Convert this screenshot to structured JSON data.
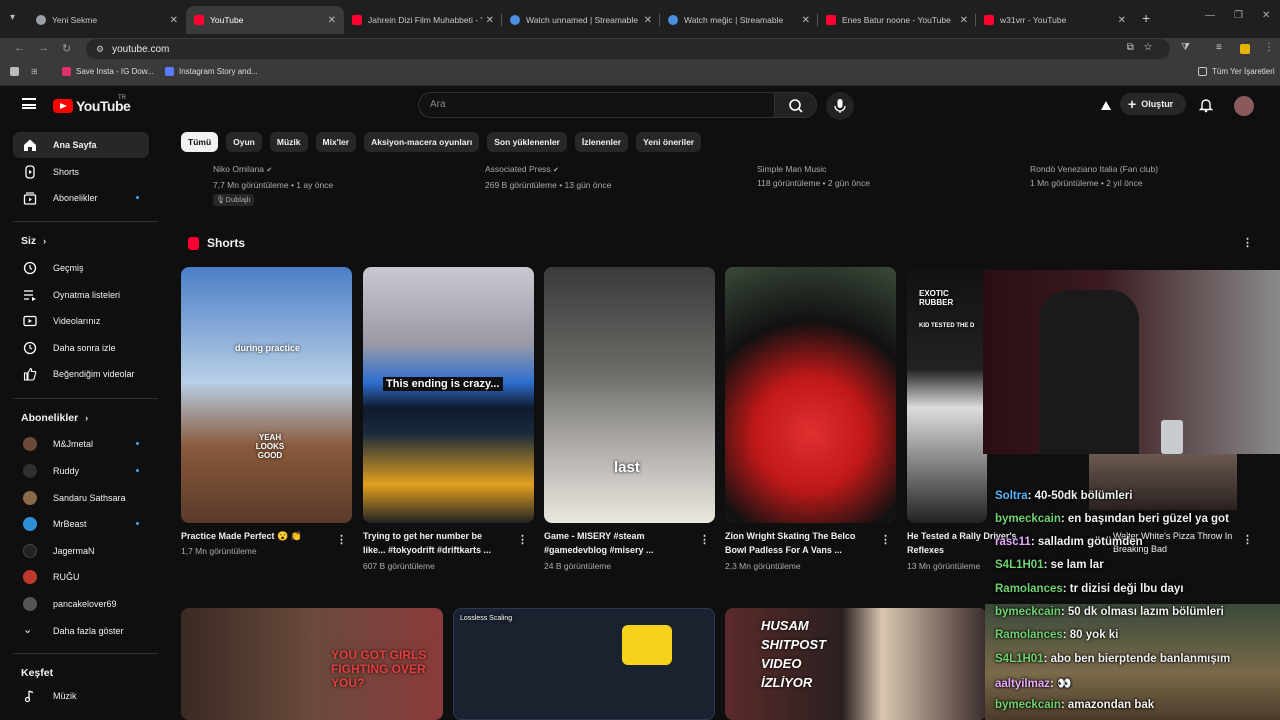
{
  "browser": {
    "tabs": [
      {
        "title": "Yeni Sekme",
        "color": "#9aa0a6"
      },
      {
        "title": "YouTube",
        "color": "#ff0033"
      },
      {
        "title": "Jahrein Dizi Film Muhabbeti - Y",
        "color": "#ff0033"
      },
      {
        "title": "Watch unnamed | Streamable",
        "color": "#4a90e2"
      },
      {
        "title": "Watch meğic | Streamable",
        "color": "#4a90e2"
      },
      {
        "title": "Enes Batur noone - YouTube",
        "color": "#ff0033"
      },
      {
        "title": "w31vrr - YouTube",
        "color": "#ff0033"
      }
    ],
    "url": "youtube.com",
    "bookmarks": [
      {
        "label": "Save Insta - IG Dow...",
        "color": "#e1306c"
      },
      {
        "label": "Instagram Story and...",
        "color": "#5b7cff"
      }
    ],
    "all_bookmarks": "Tüm Yer İşaretleri"
  },
  "yt": {
    "logo": "YouTube",
    "region": "TR",
    "search_placeholder": "Ara",
    "create": "Oluştur",
    "chips": [
      "Tümü",
      "Oyun",
      "Müzik",
      "Mix'ler",
      "Aksiyon-macera oyunları",
      "Son yüklenenler",
      "İzlenenler",
      "Yeni öneriler"
    ]
  },
  "sidebar": {
    "main": [
      "Ana Sayfa",
      "Shorts",
      "Abonelikler"
    ],
    "you_title": "Siz",
    "you": [
      "Geçmiş",
      "Oynatma listeleri",
      "Videolarınız",
      "Daha sonra izle",
      "Beğendiğim videolar"
    ],
    "subs_title": "Abonelikler",
    "subs": [
      "M&Jmetal",
      "Ruddy",
      "Sandaru Sathsara",
      "MrBeast",
      "JagermaN",
      "RUĞU",
      "pancakelover69"
    ],
    "more": "Daha fazla göster",
    "explore_title": "Keşfet",
    "explore": [
      "Müzik"
    ]
  },
  "videos_top": [
    {
      "channel": "Niko Omilana",
      "meta": "7,7 Mn görüntüleme • 1 ay önce",
      "badge": "Dublajlı"
    },
    {
      "channel": "Associated Press",
      "meta": "269 B görüntüleme • 13 gün önce"
    },
    {
      "channel": "Simple Man Music",
      "meta": "118 görüntüleme • 2 gün önce"
    },
    {
      "channel": "Rondò Veneziano Italia (Fan club)",
      "meta": "1 Mn görüntüleme • 2 yıl önce"
    }
  ],
  "shorts": {
    "title": "Shorts",
    "items": [
      {
        "title": "Practice Made Perfect 😮 👏",
        "title2": "",
        "views": "1,7 Mn görüntüleme",
        "caption": "during practice",
        "caption2": "YEAH LOOKS GOOD"
      },
      {
        "title": "Trying to get her number be",
        "title2": "like... #tokyodrift #driftkarts ...",
        "views": "607 B görüntüleme",
        "caption": "This ending is crazy..."
      },
      {
        "title": "Game - MISERY #steam",
        "title2": "#gamedevblog #misery ...",
        "views": "24 B görüntüleme",
        "caption": "last"
      },
      {
        "title": "Zion Wright Skating The Belco",
        "title2": "Bowl Padless For A Vans ...",
        "views": "2,3 Mn görüntüleme"
      },
      {
        "title": "He Tested a Rally Driver's",
        "title2": "Reflexes",
        "views": "13 Mn görüntüleme",
        "caption": "EXOTIC RUBBER",
        "caption2": "KID TESTED THE D"
      }
    ]
  },
  "row2": [
    {
      "caption": "YOU GOT GIRLS FIGHTING OVER YOU?"
    },
    {
      "caption": "Lossless Scaling"
    },
    {
      "caption": "HUSAM SHITPOST VIDEO İZLİYOR"
    }
  ],
  "overlay": {
    "behind_title": "Walter White's Pizza Throw In Breaking Bad",
    "chat": [
      {
        "user": "Soltra",
        "msg": ": 40-50dk bölümleri"
      },
      {
        "user": "bymeckcain",
        "msg": ": en başından beri güzel ya got"
      },
      {
        "user": "rasc11",
        "msg": ": salladım götümden"
      },
      {
        "user": "S4L1H01",
        "msg": ": se lam lar"
      },
      {
        "user": "Ramolances",
        "msg": ": tr dizisi deği lbu dayı"
      },
      {
        "user": "bymeckcain",
        "msg": ": 50 dk olması lazım bölümleri"
      },
      {
        "user": "Ramolances",
        "msg": ": 80 yok ki"
      },
      {
        "user": "S4L1H01",
        "msg": ": abo ben bierptende banlanmışım"
      },
      {
        "user": "aaltyilmaz",
        "msg": ": 👀"
      },
      {
        "user": "bymeckcain",
        "msg": ": amazondan bak"
      }
    ]
  }
}
